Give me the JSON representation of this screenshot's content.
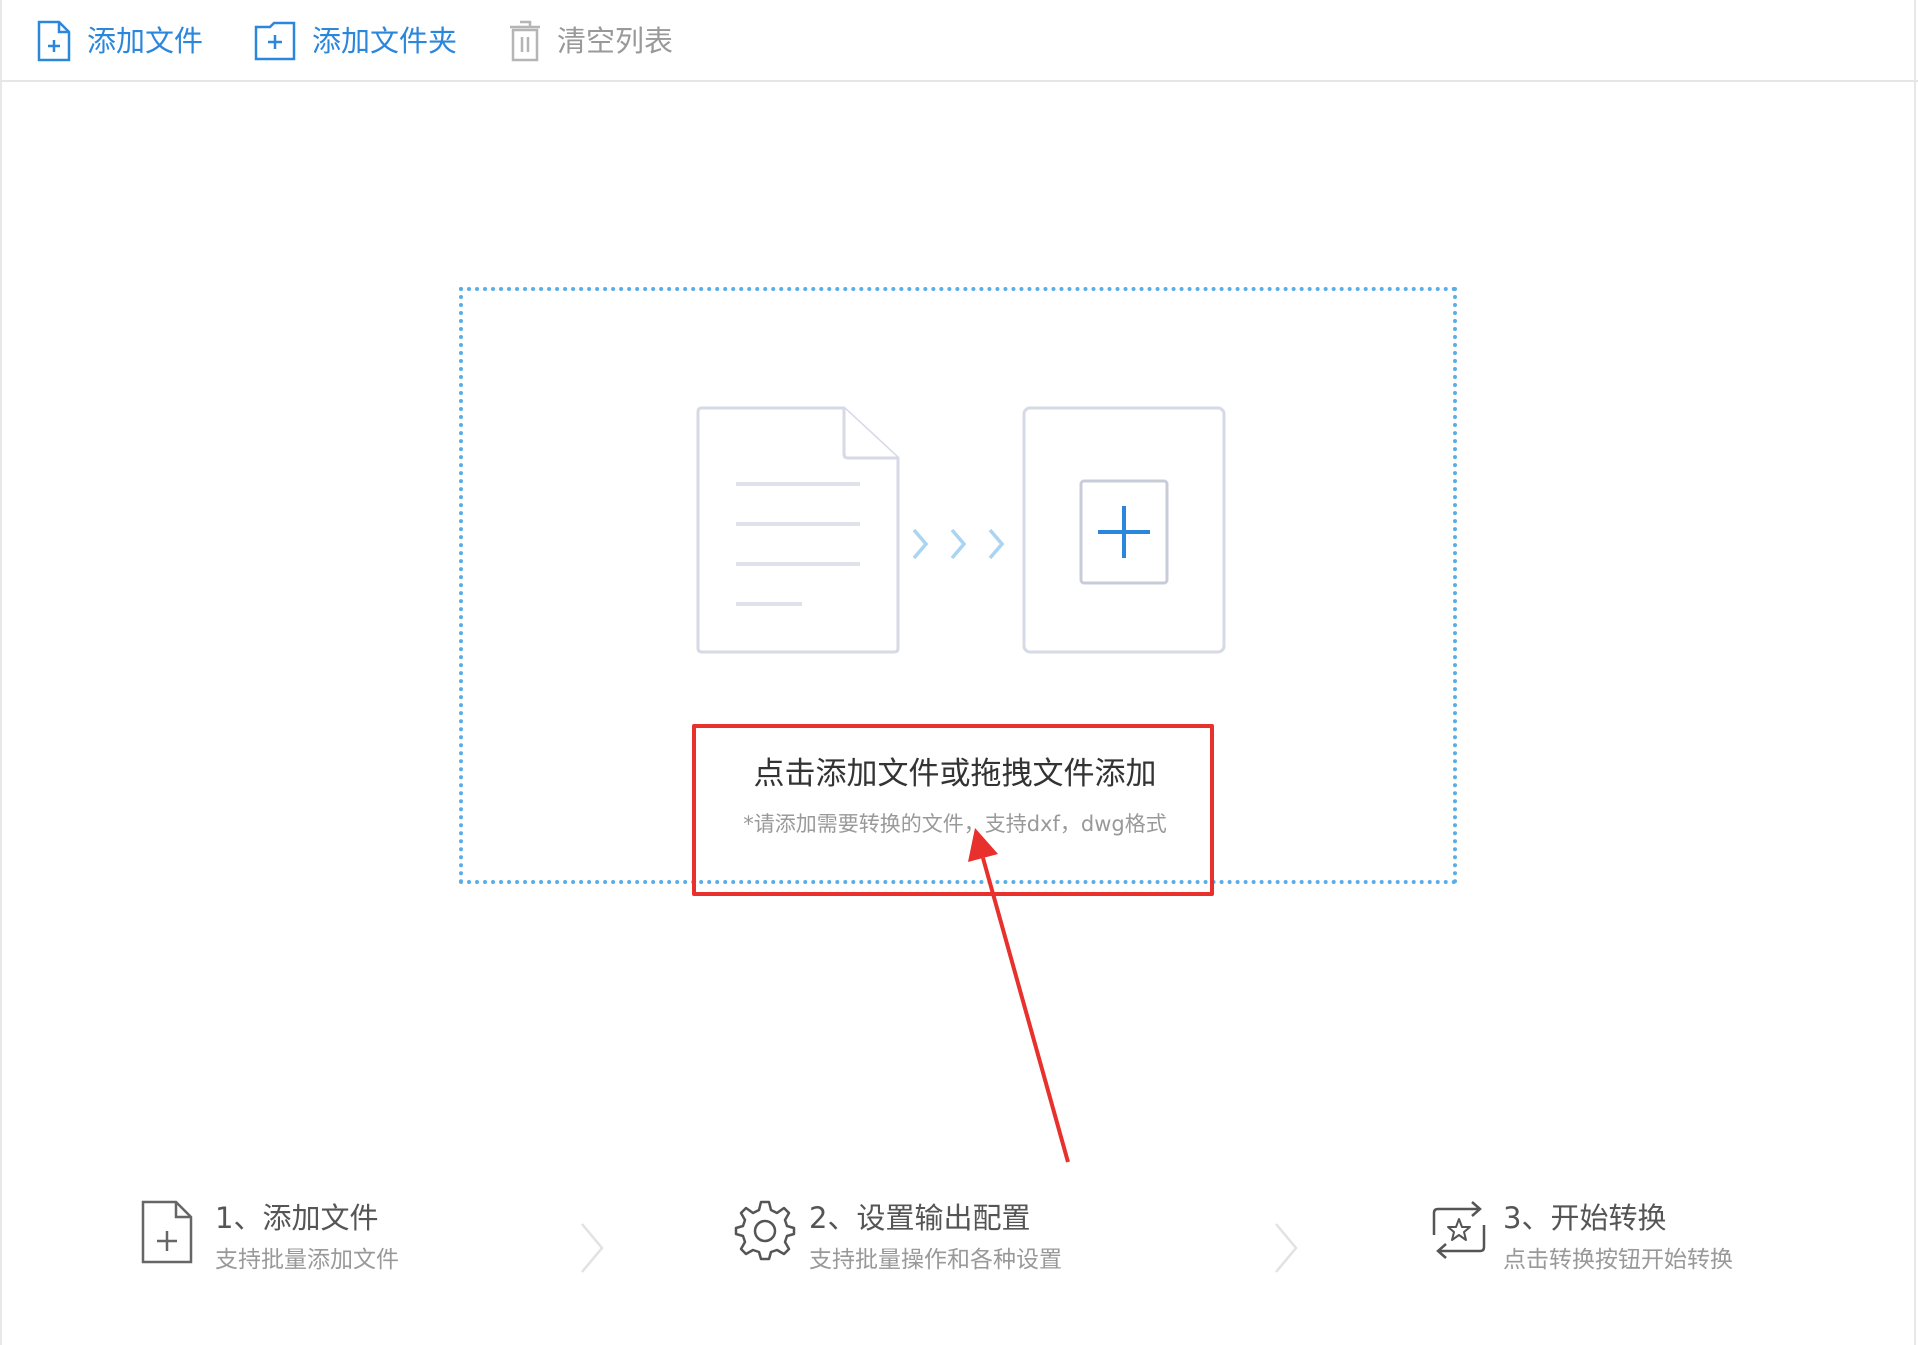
{
  "toolbar": {
    "add_file": {
      "label": "添加文件",
      "icon": "file-plus-icon"
    },
    "add_folder": {
      "label": "添加文件夹",
      "icon": "folder-plus-icon"
    },
    "clear_list": {
      "label": "清空列表",
      "icon": "trash-icon",
      "disabled": true
    }
  },
  "dropzone": {
    "main_text": "点击添加文件或拖拽文件添加",
    "sub_text": "*请添加需要转换的文件，支持dxf，dwg格式"
  },
  "steps": [
    {
      "title": "1、添加文件",
      "desc": "支持批量添加文件",
      "icon": "file-plus-icon"
    },
    {
      "title": "2、设置输出配置",
      "desc": "支持批量操作和各种设置",
      "icon": "gear-icon"
    },
    {
      "title": "3、开始转换",
      "desc": "点击转换按钮开始转换",
      "icon": "convert-star-icon"
    }
  ],
  "colors": {
    "accent": "#2b87dc",
    "dropzone_border": "#5aaee8",
    "annotation_red": "#e8302d",
    "disabled_text": "#999999"
  }
}
